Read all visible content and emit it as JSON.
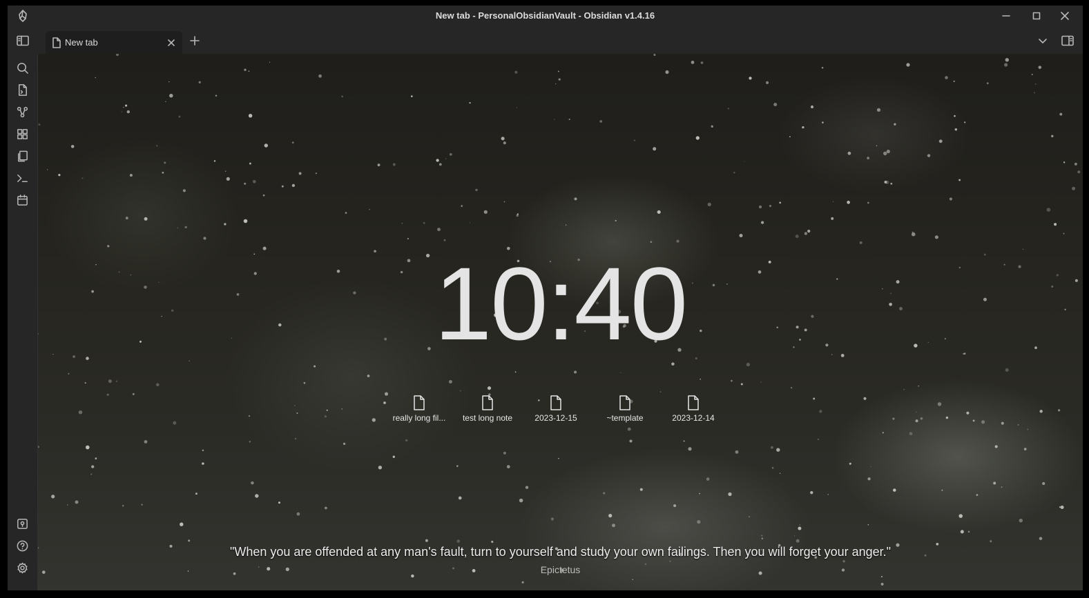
{
  "window": {
    "title": "New tab - PersonalObsidianVault - Obsidian v1.4.16"
  },
  "tabs": [
    {
      "label": "New tab",
      "active": true
    }
  ],
  "ribbon": {
    "top_icons": [
      "search-icon",
      "quick-switcher-icon",
      "graph-view-icon",
      "canvas-icon",
      "templates-icon",
      "command-palette-icon",
      "daily-note-calendar-icon"
    ],
    "bottom_icons": [
      "vault-switcher-icon",
      "help-icon",
      "settings-icon"
    ]
  },
  "clock": {
    "time": "10:40"
  },
  "recent_files": [
    {
      "label": "really long fil...",
      "icon": "file-icon"
    },
    {
      "label": "test long note",
      "icon": "file-icon"
    },
    {
      "label": "2023-12-15",
      "icon": "file-icon"
    },
    {
      "label": "~template",
      "icon": "file-icon"
    },
    {
      "label": "2023-12-14",
      "icon": "file-icon"
    }
  ],
  "quote": {
    "text": "\"When you are offended at any man's fault, turn to yourself and study your own failings. Then you will forget your anger.\"",
    "author": "Epictetus"
  },
  "colors": {
    "chrome": "#262626",
    "editor_bg": "#1e1e1e",
    "text": "#dadada"
  }
}
